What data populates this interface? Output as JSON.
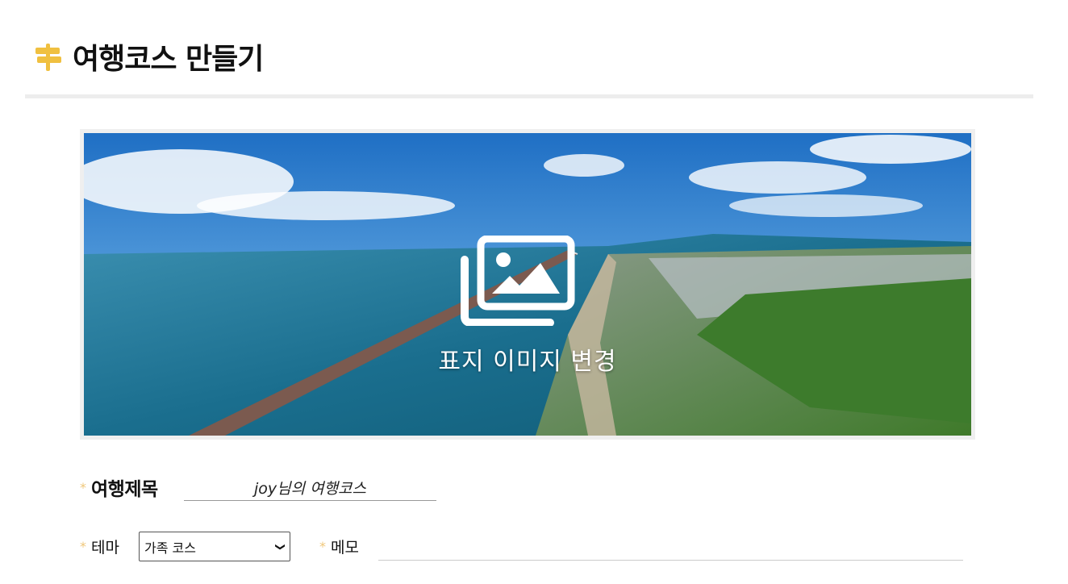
{
  "header": {
    "title": "여행코스 만들기",
    "icon": "signpost-icon",
    "icon_color": "#f0c040"
  },
  "cover": {
    "change_label": "표지 이미지 변경",
    "icon": "images-icon"
  },
  "form": {
    "required_mark": "*",
    "title_label": "여행제목",
    "title_value": "joy님의 여행코스",
    "theme_label": "테마",
    "theme_selected": "가족 코스",
    "memo_label": "메모",
    "memo_value": ""
  },
  "colors": {
    "accent": "#f0c040",
    "required": "#f0c77a",
    "divider": "#ededed"
  }
}
